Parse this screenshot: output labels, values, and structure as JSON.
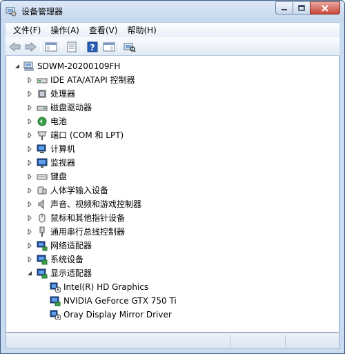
{
  "window": {
    "title": "设备管理器"
  },
  "menu": [
    {
      "key": "file",
      "label": "文件(F)"
    },
    {
      "key": "action",
      "label": "操作(A)"
    },
    {
      "key": "view",
      "label": "查看(V)"
    },
    {
      "key": "help",
      "label": "帮助(H)"
    }
  ],
  "tree": {
    "root": {
      "label": "SDWM-20200109FH",
      "icon": "computer-icon",
      "expanded": true
    },
    "categories": [
      {
        "label": "IDE ATA/ATAPI 控制器",
        "icon": "ide-controller-icon",
        "expanded": false
      },
      {
        "label": "处理器",
        "icon": "processor-icon",
        "expanded": false
      },
      {
        "label": "磁盘驱动器",
        "icon": "disk-drive-icon",
        "expanded": false
      },
      {
        "label": "电池",
        "icon": "battery-icon",
        "expanded": false
      },
      {
        "label": "端口 (COM 和 LPT)",
        "icon": "port-icon",
        "expanded": false
      },
      {
        "label": "计算机",
        "icon": "computer-icon",
        "expanded": false
      },
      {
        "label": "监视器",
        "icon": "monitor-icon",
        "expanded": false
      },
      {
        "label": "键盘",
        "icon": "keyboard-icon",
        "expanded": false
      },
      {
        "label": "人体学输入设备",
        "icon": "hid-icon",
        "expanded": false
      },
      {
        "label": "声音、视频和游戏控制器",
        "icon": "speaker-icon",
        "expanded": false
      },
      {
        "label": "鼠标和其他指针设备",
        "icon": "mouse-icon",
        "expanded": false
      },
      {
        "label": "通用串行总线控制器",
        "icon": "usb-icon",
        "expanded": false
      },
      {
        "label": "网络适配器",
        "icon": "network-adapter-icon",
        "expanded": false
      },
      {
        "label": "系统设备",
        "icon": "system-device-icon",
        "expanded": false
      },
      {
        "label": "显示适配器",
        "icon": "display-adapter-icon",
        "expanded": true
      }
    ],
    "display_adapters": [
      {
        "label": "Intel(R) HD Graphics",
        "icon": "display-adapter-warning-icon"
      },
      {
        "label": "NVIDIA GeForce GTX 750 Ti",
        "icon": "display-adapter-icon"
      },
      {
        "label": "Oray Display Mirror Driver",
        "icon": "display-adapter-warning-icon"
      }
    ]
  }
}
